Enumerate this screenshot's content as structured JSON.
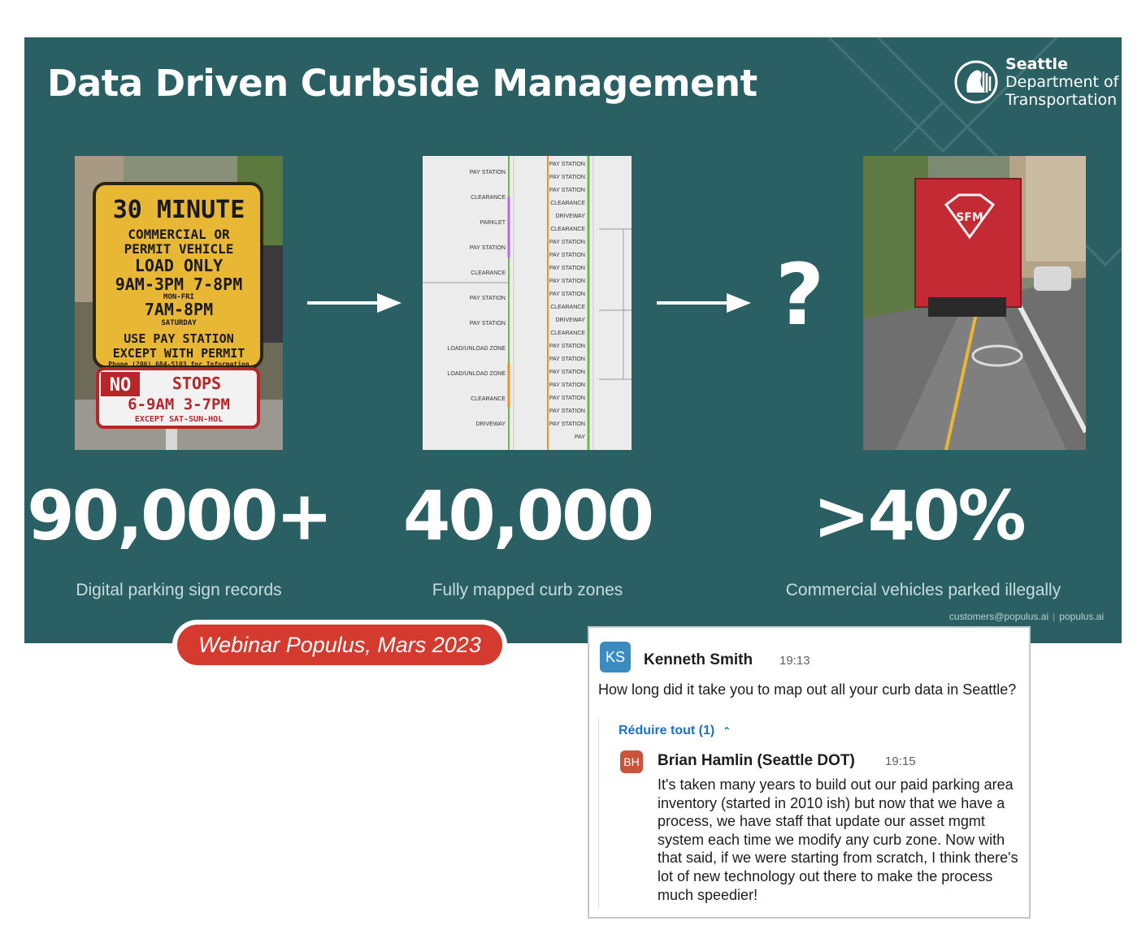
{
  "slide": {
    "title": "Data Driven Curbside Management",
    "logo": {
      "line1": "Seattle",
      "line2": "Department of",
      "line3": "Transportation"
    },
    "sign": {
      "lines": [
        "30 MINUTE",
        "COMMERCIAL OR",
        "PERMIT VEHICLE",
        "LOAD ONLY",
        "9AM-3PM 7-8PM",
        "MON-FRI",
        "7AM-8PM",
        "SATURDAY",
        "USE PAY STATION",
        "EXCEPT WITH PERMIT",
        "Phone (206) 684-5103 for Information"
      ],
      "no_stops": [
        "NO",
        "STOPS",
        "6-9AM 3-7PM",
        "EXCEPT SAT-SUN-HOL"
      ]
    },
    "curb_map": {
      "left_col": [
        "PAY STATION",
        "CLEARANCE",
        "PARKLET",
        "PAY STATION",
        "CLEARANCE",
        "PAY STATION",
        "PAY STATION",
        "LOAD/UNLOAD ZONE",
        "LOAD/UNLOAD ZONE",
        "CLEARANCE",
        "DRIVEWAY"
      ],
      "right_col": [
        "PAY STATION",
        "PAY STATION",
        "PAY STATION",
        "CLEARANCE",
        "DRIVEWAY",
        "CLEARANCE",
        "PAY STATION",
        "PAY STATION",
        "PAY STATION",
        "PAY STATION",
        "PAY STATION",
        "CLEARANCE",
        "DRIVEWAY",
        "CLEARANCE",
        "PAY STATION",
        "PAY STATION",
        "PAY STATION",
        "PAY STATION",
        "PAY STATION",
        "PAY STATION",
        "PAY STATION",
        "PAY"
      ]
    },
    "truck_text": "SFM",
    "question_mark": "?",
    "stats": [
      {
        "value": "90,000+",
        "label": "Digital parking sign records"
      },
      {
        "value": "40,000",
        "label": "Fully mapped curb zones"
      },
      {
        "value": ">40%",
        "label": "Commercial vehicles parked illegally"
      }
    ],
    "footer": {
      "email": "customers@populus.ai",
      "site": "populus.ai"
    }
  },
  "banner": "Webinar Populus, Mars 2023",
  "chat": {
    "message": {
      "initials": "KS",
      "author": "Kenneth Smith",
      "time": "19:13",
      "text": "How long did it take you to map out all your curb data in Seattle?"
    },
    "collapse_label": "Réduire tout (1)",
    "reply": {
      "initials": "BH",
      "author": "Brian Hamlin (Seattle DOT)",
      "time": "19:15",
      "text": "It's taken many years to build out our paid parking area inventory (started in 2010 ish) but now that we have a process, we have staff that update our asset mgmt system each time we modify any curb zone. Now with that said, if we were starting from scratch, I think there's lot of new technology out there to make the process much speedier!"
    },
    "colors": {
      "ks_avatar": "#3a8cc0",
      "bh_avatar": "#c8553a",
      "link": "#1a73c8"
    }
  },
  "colors": {
    "slide_bg": "#2a6064",
    "banner_red": "#d53a2e"
  }
}
